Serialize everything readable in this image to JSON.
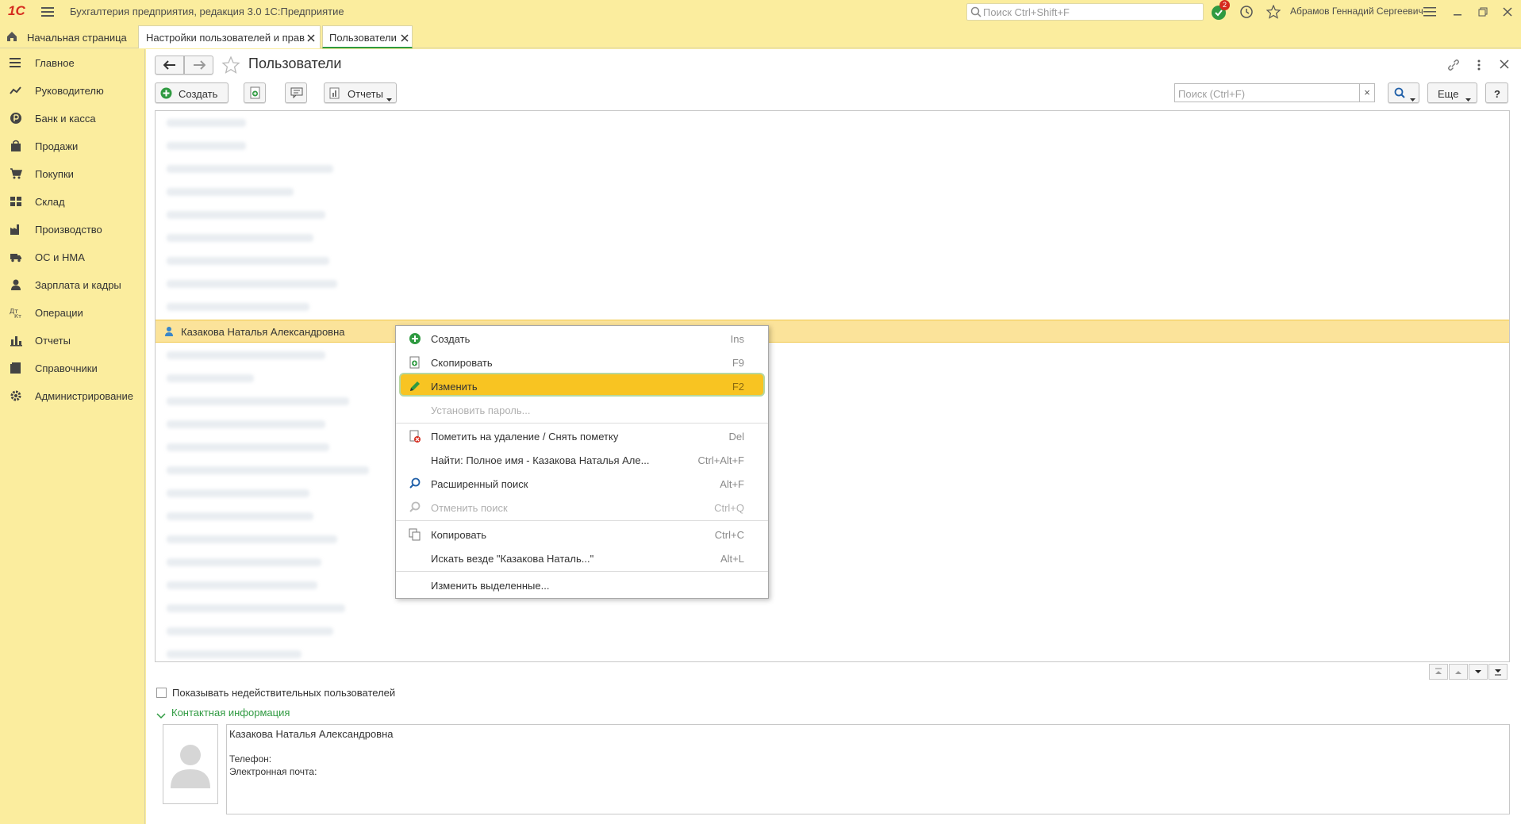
{
  "titlebar": {
    "logo": "1С",
    "title": "Бухгалтерия предприятия, редакция 3.0 1С:Предприятие",
    "search_placeholder": "Поиск Ctrl+Shift+F",
    "notification_count": "2",
    "user": "Абрамов Геннадий Сергеевич"
  },
  "tabs": {
    "home": "Начальная страница",
    "tab1": "Настройки пользователей и прав",
    "tab2": "Пользователи"
  },
  "sidebar": {
    "items": [
      {
        "label": "Главное",
        "icon": "menu-lines-icon"
      },
      {
        "label": "Руководителю",
        "icon": "trend-icon"
      },
      {
        "label": "Банк и касса",
        "icon": "ruble-coin-icon"
      },
      {
        "label": "Продажи",
        "icon": "shopping-bag-icon"
      },
      {
        "label": "Покупки",
        "icon": "cart-icon"
      },
      {
        "label": "Склад",
        "icon": "warehouse-icon"
      },
      {
        "label": "Производство",
        "icon": "factory-icon"
      },
      {
        "label": "ОС и НМА",
        "icon": "truck-icon"
      },
      {
        "label": "Зарплата и кадры",
        "icon": "person-icon"
      },
      {
        "label": "Операции",
        "icon": "operations-icon"
      },
      {
        "label": "Отчеты",
        "icon": "bar-chart-icon"
      },
      {
        "label": "Справочники",
        "icon": "book-icon"
      },
      {
        "label": "Администрирование",
        "icon": "gear-icon"
      }
    ]
  },
  "page": {
    "title": "Пользователи"
  },
  "toolbar": {
    "create_label": "Создать",
    "reports_label": "Отчеты",
    "search_placeholder": "Поиск (Ctrl+F)",
    "search_clear": "×",
    "more_label": "Еще",
    "help_label": "?"
  },
  "list": {
    "selected_user": "Казакова Наталья Александровна"
  },
  "context_menu": {
    "items": [
      {
        "label": "Создать",
        "shortcut": "Ins",
        "icon": "plus-circle-icon"
      },
      {
        "label": "Скопировать",
        "shortcut": "F9",
        "icon": "copy-doc-icon"
      },
      {
        "label": "Изменить",
        "shortcut": "F2",
        "icon": "pencil-icon"
      },
      {
        "label": "Установить пароль...",
        "shortcut": ""
      },
      {
        "label": "Пометить на удаление / Снять пометку",
        "shortcut": "Del",
        "icon": "delete-mark-icon"
      },
      {
        "label": "Найти: Полное имя - Казакова Наталья Але...",
        "shortcut": "Ctrl+Alt+F"
      },
      {
        "label": "Расширенный поиск",
        "shortcut": "Alt+F",
        "icon": "search-icon"
      },
      {
        "label": "Отменить поиск",
        "shortcut": "Ctrl+Q",
        "icon": "cancel-search-icon"
      },
      {
        "label": "Копировать",
        "shortcut": "Ctrl+C",
        "icon": "copy-icon"
      },
      {
        "label": "Искать везде \"Казакова Наталь...\"",
        "shortcut": "Alt+L"
      },
      {
        "label": "Изменить выделенные...",
        "shortcut": ""
      }
    ]
  },
  "bottom": {
    "show_invalid_label": "Показывать недействительных пользователей",
    "contact_section_label": "Контактная информация",
    "contact_name": "Казакова Наталья Александровна",
    "phone_label": "Телефон:",
    "email_label": "Электронная почта:"
  },
  "colors": {
    "accent_yellow": "#fbed9e",
    "selected_row": "#fbe39a",
    "menu_highlight": "#f8c422",
    "logo_red": "#d52b1e",
    "green": "#2f9a41"
  }
}
